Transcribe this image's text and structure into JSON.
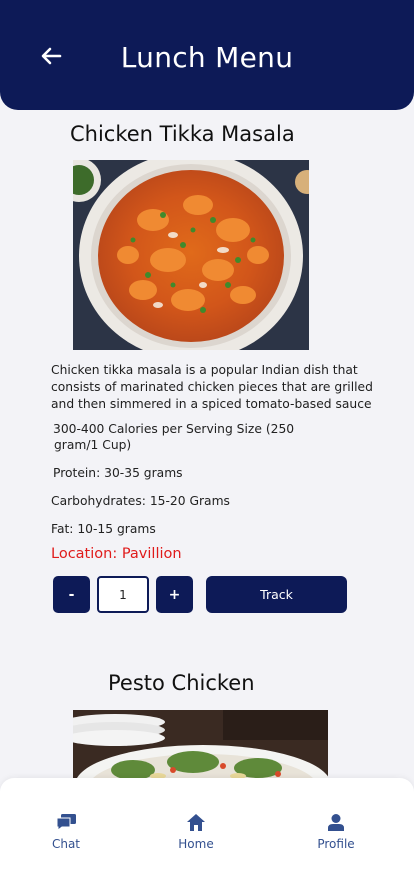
{
  "header": {
    "title": "Lunch Menu",
    "back_icon": "arrow-left-icon"
  },
  "dishes": [
    {
      "name": "Chicken Tikka Masala",
      "description": [
        "Chicken tikka masala is a popular Indian dish that",
        "consists of marinated chicken pieces that are grilled",
        "and then simmered in a spiced tomato-based sauce"
      ],
      "calories": [
        "300-400 Calories per Serving Size (250",
        "gram/1 Cup)"
      ],
      "protein": "Protein: 30-35 grams",
      "carbs": "Carbohydrates: 15-20 Grams",
      "fat": "Fat: 10-15 grams",
      "location": "Location: Pavillion",
      "quantity": "1",
      "minus_label": "-",
      "plus_label": "+",
      "track_label": "Track"
    },
    {
      "name": "Pesto Chicken"
    }
  ],
  "nav": [
    {
      "label": "Chat",
      "icon": "chat-icon"
    },
    {
      "label": "Home",
      "icon": "home-icon"
    },
    {
      "label": "Profile",
      "icon": "profile-icon"
    }
  ],
  "colors": {
    "primary": "#0d1a57",
    "background": "#f3f3f7",
    "location": "#e01b1b",
    "nav_label": "#33508f"
  }
}
